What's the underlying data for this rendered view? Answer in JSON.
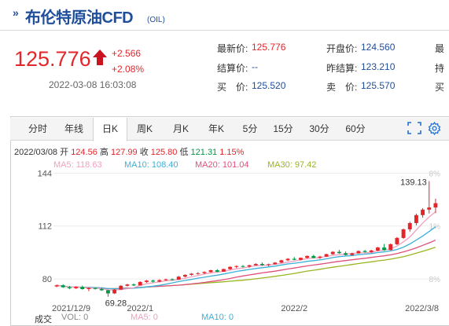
{
  "header": {
    "arrows": "»",
    "name": "布伦特原油CFD",
    "code": "(OIL)"
  },
  "quote": {
    "price": "125.776",
    "change": "+2.566",
    "change_pct": "+2.08%",
    "timestamp": "2022-03-08 16:03:08",
    "fields": [
      {
        "label": "最新价:",
        "value": "125.776",
        "color": "#e3262a"
      },
      {
        "label": "结算价:",
        "value": "--",
        "color": "#1f4e9b"
      },
      {
        "label": "买　价:",
        "value": "125.520",
        "color": "#1f4e9b"
      },
      {
        "label": "开盘价:",
        "value": "124.560",
        "color": "#1f4e9b"
      },
      {
        "label": "昨结算:",
        "value": "123.210",
        "color": "#1f4e9b"
      },
      {
        "label": "卖　价:",
        "value": "125.570",
        "color": "#1f4e9b"
      },
      {
        "label": "最",
        "value": ""
      },
      {
        "label": "持",
        "value": ""
      },
      {
        "label": "买",
        "value": ""
      }
    ]
  },
  "tabs": [
    "分时",
    "年线",
    "日K",
    "周K",
    "月K",
    "年K",
    "5分",
    "15分",
    "30分",
    "60分"
  ],
  "active_tab": "日K",
  "toolbar_icons": [
    "fullscreen-icon",
    "settings-icon"
  ],
  "ohlc_bar": {
    "date": "2022/03/08",
    "open_label": "开",
    "open": "124.56",
    "high_label": "高",
    "high": "127.99",
    "close_label": "收",
    "close": "125.80",
    "low_label": "低",
    "low": "121.31",
    "pct": "1.15%"
  },
  "ma_bar": [
    {
      "label": "MA5: 118.63",
      "color": "#f0a0c0"
    },
    {
      "label": "MA10: 108.40",
      "color": "#3bb0d8"
    },
    {
      "label": "MA20: 101.04",
      "color": "#e0507a"
    },
    {
      "label": "MA30: 97.42",
      "color": "#9ab520"
    }
  ],
  "volume_bar": [
    {
      "label": "成交",
      "color": "#333333"
    },
    {
      "label": "VOL: 0",
      "color": "#888888"
    },
    {
      "label": "MA5: 0",
      "color": "#f0a0c0"
    },
    {
      "label": "MA10: 0",
      "color": "#3bb0d8"
    }
  ],
  "chart_data": {
    "type": "candlestick",
    "y_ticks": [
      "144",
      "112",
      "80"
    ],
    "y_tick_values": [
      144,
      112,
      80
    ],
    "ylim": [
      72,
      147
    ],
    "right_ticks": [
      "8%",
      "1%",
      "8%"
    ],
    "x_labels": [
      "2021/12/9",
      "2022/1",
      "2022/2",
      "2022/3/8"
    ],
    "annotations": {
      "max": "139.13",
      "min": "69.28"
    },
    "candles": [
      [
        75.5,
        76.6,
        75.0,
        76.2
      ],
      [
        76.2,
        76.8,
        74.6,
        75.0
      ],
      [
        75.0,
        75.8,
        73.8,
        74.4
      ],
      [
        74.4,
        75.6,
        74.0,
        75.2
      ],
      [
        75.2,
        76.0,
        73.6,
        73.9
      ],
      [
        73.9,
        74.8,
        72.6,
        74.5
      ],
      [
        74.5,
        75.1,
        73.6,
        74.0
      ],
      [
        74.0,
        74.9,
        72.8,
        73.2
      ],
      [
        73.2,
        73.6,
        69.28,
        71.3
      ],
      [
        71.3,
        73.9,
        70.9,
        73.6
      ],
      [
        73.6,
        76.3,
        73.4,
        75.9
      ],
      [
        75.9,
        77.0,
        75.4,
        76.7
      ],
      [
        76.7,
        77.3,
        75.8,
        76.1
      ],
      [
        76.1,
        78.6,
        76.0,
        78.2
      ],
      [
        78.2,
        79.4,
        77.6,
        79.0
      ],
      [
        79.0,
        79.6,
        77.9,
        78.4
      ],
      [
        78.4,
        79.8,
        78.1,
        79.3
      ],
      [
        79.3,
        80.2,
        78.8,
        79.8
      ],
      [
        79.8,
        80.4,
        79.1,
        79.6
      ],
      [
        79.6,
        81.8,
        79.5,
        81.4
      ],
      [
        81.4,
        82.8,
        81.0,
        82.5
      ],
      [
        82.5,
        83.6,
        82.0,
        83.2
      ],
      [
        83.2,
        84.1,
        82.6,
        83.5
      ],
      [
        83.5,
        84.6,
        82.9,
        84.2
      ],
      [
        84.2,
        85.6,
        83.8,
        85.3
      ],
      [
        85.3,
        85.9,
        84.0,
        84.4
      ],
      [
        84.4,
        86.2,
        84.3,
        86.0
      ],
      [
        86.0,
        87.6,
        85.6,
        87.3
      ],
      [
        87.3,
        88.2,
        86.6,
        87.8
      ],
      [
        87.8,
        88.4,
        87.0,
        87.5
      ],
      [
        87.5,
        88.6,
        86.8,
        88.3
      ],
      [
        88.3,
        89.5,
        88.0,
        89.1
      ],
      [
        89.1,
        90.0,
        87.9,
        88.4
      ],
      [
        88.4,
        89.3,
        87.7,
        88.9
      ],
      [
        88.9,
        90.2,
        88.6,
        89.9
      ],
      [
        89.9,
        91.6,
        89.6,
        91.3
      ],
      [
        91.3,
        92.6,
        90.8,
        92.2
      ],
      [
        92.2,
        93.3,
        91.3,
        91.6
      ],
      [
        91.6,
        93.0,
        91.2,
        92.8
      ],
      [
        92.8,
        94.2,
        92.3,
        93.9
      ],
      [
        93.9,
        94.6,
        92.4,
        92.8
      ],
      [
        92.8,
        94.0,
        92.1,
        93.5
      ],
      [
        93.5,
        95.3,
        93.3,
        95.0
      ],
      [
        95.0,
        96.8,
        94.6,
        96.4
      ],
      [
        96.4,
        97.6,
        95.2,
        95.6
      ],
      [
        95.6,
        96.6,
        94.2,
        94.5
      ],
      [
        94.5,
        95.9,
        94.0,
        95.5
      ],
      [
        95.5,
        97.2,
        95.3,
        96.9
      ],
      [
        96.9,
        97.6,
        95.9,
        96.3
      ],
      [
        96.3,
        97.6,
        95.8,
        97.2
      ],
      [
        97.2,
        99.4,
        96.7,
        99.0
      ],
      [
        99.0,
        101.2,
        97.0,
        97.5
      ],
      [
        97.5,
        101.5,
        97.3,
        101.0
      ],
      [
        101.0,
        105.4,
        100.5,
        104.8
      ],
      [
        104.8,
        110.5,
        104.2,
        110.0
      ],
      [
        110.0,
        114.6,
        108.5,
        113.8
      ],
      [
        113.8,
        119.5,
        112.4,
        118.6
      ],
      [
        118.6,
        122.8,
        117.0,
        121.9
      ],
      [
        121.9,
        139.13,
        119.6,
        123.2
      ],
      [
        123.2,
        128.5,
        119.8,
        125.8
      ]
    ]
  }
}
